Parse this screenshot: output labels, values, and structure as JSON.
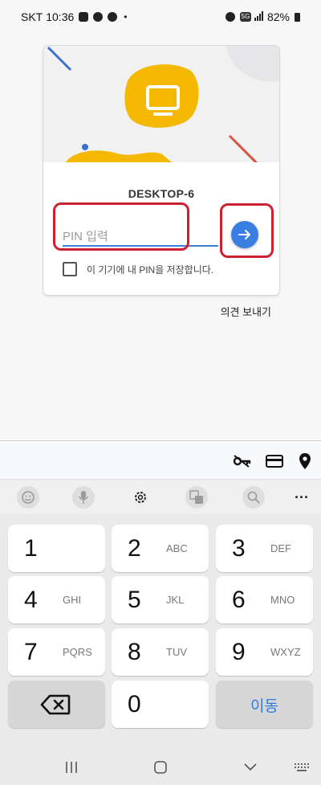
{
  "status_bar": {
    "carrier": "SKT",
    "time": "10:36",
    "dot": "•",
    "network_label": "5G",
    "battery_level": "82%"
  },
  "card": {
    "host_name": "DESKTOP-6",
    "pin_placeholder": "PIN 입력",
    "pin_value": "",
    "save_pin_label": "이 기기에 내 PIN을 저장합니다.",
    "save_pin_checked": false
  },
  "feedback_label": "의견 보내기",
  "colors": {
    "accent": "#3a7ee4",
    "highlight": "#cc2131",
    "hero_blob": "#f5b800",
    "hero_line_blue": "#3b6fd0",
    "hero_line_red": "#d9533f"
  },
  "autofill_bar": {
    "icons": [
      "password-key-icon",
      "credit-card-icon",
      "location-pin-icon"
    ]
  },
  "keyboard": {
    "toolbar_icons": [
      "emoji-icon",
      "microphone-icon",
      "settings-icon",
      "translate-icon",
      "search-icon",
      "more-icon"
    ],
    "more_glyph": "···",
    "keys": [
      {
        "number": "1",
        "letters": ""
      },
      {
        "number": "2",
        "letters": "ABC"
      },
      {
        "number": "3",
        "letters": "DEF"
      },
      {
        "number": "4",
        "letters": "GHI"
      },
      {
        "number": "5",
        "letters": "JKL"
      },
      {
        "number": "6",
        "letters": "MNO"
      },
      {
        "number": "7",
        "letters": "PQRS"
      },
      {
        "number": "8",
        "letters": "TUV"
      },
      {
        "number": "9",
        "letters": "WXYZ"
      },
      {
        "number": "0",
        "letters": ""
      }
    ],
    "go_label": "이동"
  },
  "nav_bar": {
    "buttons": [
      "recents-icon",
      "home-icon",
      "back-icon",
      "keyboard-switch-icon"
    ]
  }
}
